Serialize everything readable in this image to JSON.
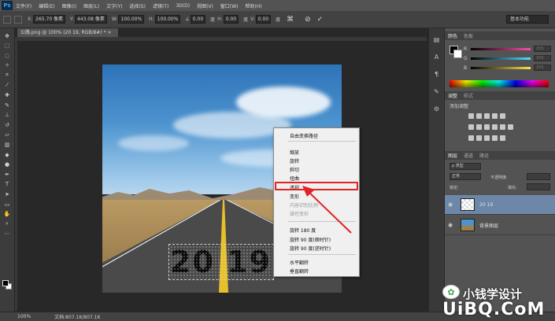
{
  "app": {
    "logo": "Ps"
  },
  "menu": [
    "文件(F)",
    "编辑(E)",
    "图像(I)",
    "图层(L)",
    "文字(Y)",
    "选择(S)",
    "滤镜(T)",
    "3D(D)",
    "视图(V)",
    "窗口(W)",
    "帮助(H)"
  ],
  "options": {
    "x_label": "X:",
    "x_value": "265.70 像素",
    "y_label": "Y:",
    "y_value": "443.08 像素",
    "w_label": "W:",
    "w_value": "100.00%",
    "h_label": "H:",
    "h_value": "100.00%",
    "angle_value": "0.00",
    "angle_unit": "度",
    "h_skew_label": "H:",
    "h_skew_value": "0.00",
    "h_skew_unit": "度",
    "v_skew_label": "V:",
    "v_skew_value": "0.00",
    "v_skew_unit": "度",
    "workspace": "基本功能"
  },
  "document": {
    "tab_title": "公路.png @ 100% (20 19, RGB/8#) * ×"
  },
  "canvas_text": "20 19",
  "context_menu": {
    "items": [
      "自由变换路径",
      "缩放",
      "旋转",
      "斜切",
      "扭曲",
      "透视",
      "变形",
      "内容识别比例",
      "操控变形",
      "旋转 180 度",
      "旋转 90 度(顺时针)",
      "旋转 90 度(逆时针)",
      "水平翻转",
      "垂直翻转"
    ],
    "highlighted": "透视",
    "disabled": [
      "内容识别比例",
      "操控变形"
    ]
  },
  "color_panel": {
    "tabs": [
      "颜色",
      "色板"
    ],
    "sliders": [
      {
        "letter": "R",
        "value": "255",
        "color": "#ff4da6"
      },
      {
        "letter": "G",
        "value": "255",
        "color": "#4ddcff"
      },
      {
        "letter": "B",
        "value": "255",
        "color": "#ffe14d"
      }
    ]
  },
  "adjustments_panel": {
    "tabs": [
      "调整",
      "样式"
    ],
    "title": "添加调整"
  },
  "layers_panel": {
    "tabs": [
      "图层",
      "通道",
      "路径"
    ],
    "kind": "ρ 类型",
    "blend_mode": "正常",
    "opacity_label": "不透明度:",
    "lock_label": "锁定:",
    "fill_label": "填充:",
    "layers": [
      {
        "name": "20 19",
        "selected": true
      },
      {
        "name": "背景图层",
        "selected": false
      }
    ]
  },
  "status": {
    "zoom": "100%",
    "doc_size": "文档:807.1K/807.1K"
  },
  "watermark": {
    "channel": "小钱学设计",
    "site": "UiBQ.CoM"
  },
  "colors": {
    "menu_bar": "#535353",
    "options_bar": "#424242",
    "canvas_bg": "#282828",
    "highlight_red": "#e02424",
    "selected_layer": "#6d87a8"
  },
  "icons": [
    "move-icon",
    "marquee-icon",
    "lasso-icon",
    "magic-wand-icon",
    "crop-icon",
    "eyedropper-icon",
    "healing-icon",
    "brush-icon",
    "stamp-icon",
    "history-brush-icon",
    "eraser-icon",
    "gradient-icon",
    "blur-icon",
    "dodge-icon",
    "pen-icon",
    "type-icon",
    "path-select-icon",
    "shape-icon",
    "hand-icon",
    "zoom-icon",
    "cancel-icon",
    "commit-icon",
    "eye-icon",
    "wechat-icon"
  ]
}
